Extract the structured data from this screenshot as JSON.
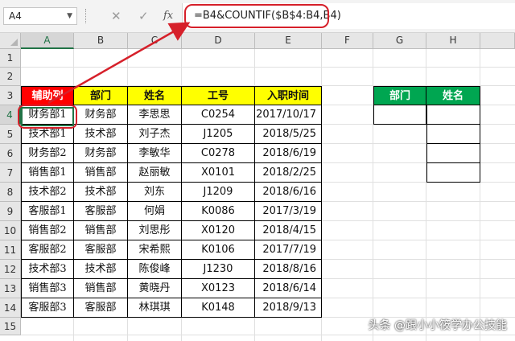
{
  "formula_bar": {
    "name_box": "A4",
    "cancel_icon": "✕",
    "enter_icon": "✓",
    "fx_label": "fx",
    "formula": "=B4&COUNTIF($B$4:B4,B4)"
  },
  "columns": [
    "A",
    "B",
    "C",
    "D",
    "E",
    "F",
    "G",
    "H"
  ],
  "rows": [
    "1",
    "2",
    "3",
    "4",
    "5",
    "6",
    "7",
    "8",
    "9",
    "10",
    "11",
    "12",
    "13",
    "14",
    "15"
  ],
  "table": {
    "headers": [
      "辅助列",
      "部门",
      "姓名",
      "工号",
      "入职时间"
    ],
    "rows": [
      [
        "财务部1",
        "财务部",
        "李思思",
        "C0254",
        "2017/10/17"
      ],
      [
        "技术部1",
        "技术部",
        "刘子杰",
        "J1205",
        "2018/5/25"
      ],
      [
        "财务部2",
        "财务部",
        "李敏华",
        "C0278",
        "2018/6/19"
      ],
      [
        "销售部1",
        "销售部",
        "赵丽敏",
        "X0101",
        "2018/2/25"
      ],
      [
        "技术部2",
        "技术部",
        "刘东",
        "J1209",
        "2018/6/16"
      ],
      [
        "客服部1",
        "客服部",
        "何娟",
        "K0086",
        "2017/3/19"
      ],
      [
        "销售部2",
        "销售部",
        "刘思彤",
        "X0120",
        "2018/4/15"
      ],
      [
        "客服部2",
        "客服部",
        "宋希熙",
        "K0106",
        "2017/7/19"
      ],
      [
        "技术部3",
        "技术部",
        "陈俊峰",
        "J1230",
        "2018/8/16"
      ],
      [
        "销售部3",
        "销售部",
        "黄晓丹",
        "X0123",
        "2018/6/14"
      ],
      [
        "客服部3",
        "客服部",
        "林琪琪",
        "K0148",
        "2018/9/13"
      ]
    ]
  },
  "lookup": {
    "headers": [
      "部门",
      "姓名"
    ]
  },
  "watermark": "头条 @跟小小筱学办公技能",
  "colors": {
    "header_yellow": "#ffff00",
    "header_red": "#ff0000",
    "header_green": "#00a651",
    "highlight_red": "#d6202a",
    "excel_green": "#217346"
  }
}
